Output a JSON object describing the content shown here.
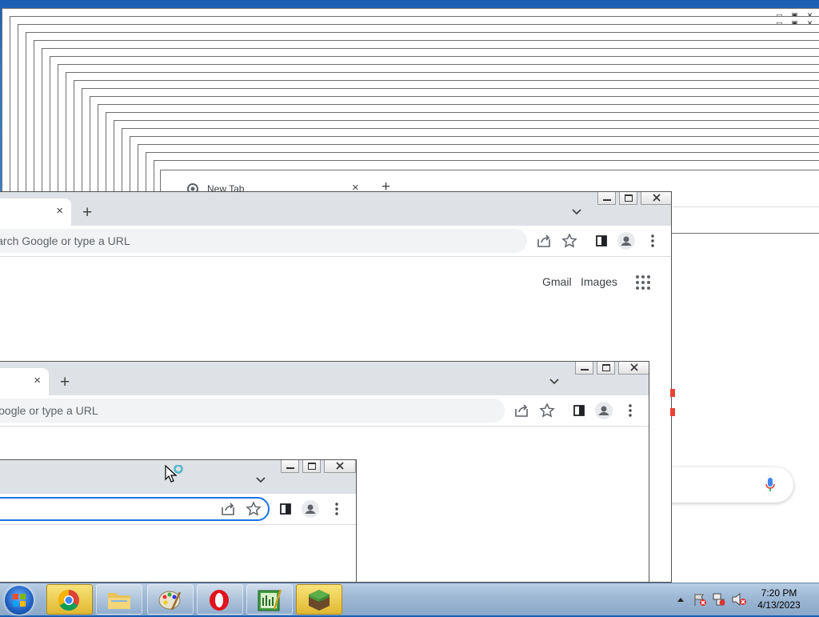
{
  "background_window": {
    "tab_title": "New Tab",
    "new_tab": "+",
    "tab_close": "×"
  },
  "window_large": {
    "tab_close": "×",
    "new_tab": "+",
    "omnibox_text": "Search Google or type a URL",
    "gmail_link": "Gmail",
    "images_link": "Images"
  },
  "window_medium": {
    "tab_close": "×",
    "new_tab": "+",
    "omnibox_text": "Search Google or type a URL"
  },
  "window_small": {
    "omnibox_text": ""
  },
  "taskbar": {
    "apps": [
      "chrome",
      "file-explorer",
      "paint",
      "opera",
      "chart-app",
      "minecraft"
    ],
    "clock_time": "7:20 PM",
    "clock_date": "4/13/2023"
  },
  "colors": {
    "accent": "#1a73e8",
    "tab_strip": "#dee1e6",
    "taskbar_active": "#e0b830"
  }
}
